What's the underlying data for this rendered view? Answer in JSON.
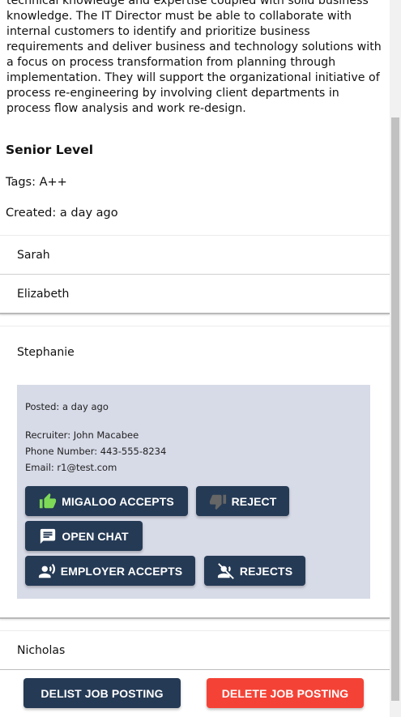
{
  "job": {
    "description": "technical knowledge and expertise coupled with solid business knowledge. The IT Director must be able to collaborate with internal customers to identify and prioritize business requirements and deliver business and technology solutions with a focus on process transformation from planning through implementation. They will support the organizational initiative of process re-engineering by involving client departments in process flow analysis and work re-design.",
    "level": "Senior Level",
    "tags": "Tags: A++",
    "created": "Created: a day ago"
  },
  "candidates": [
    {
      "name": "Sarah"
    },
    {
      "name": "Elizabeth"
    },
    {
      "name": "Stephanie"
    },
    {
      "name": "Nicholas"
    }
  ],
  "details": {
    "posted": "Posted: a day ago",
    "recruiter": "Recruiter: John Macabee",
    "phone": "Phone Number: 443-555-8234",
    "email": "Email: r1@test.com"
  },
  "actions": {
    "migaloo_accepts": "MIGALOO ACCEPTS",
    "reject": "REJECT",
    "open_chat": "OPEN CHAT",
    "employer_accepts": "EMPLOYER ACCEPTS",
    "rejects": "REJECTS"
  },
  "footer": {
    "delist": "DELIST JOB POSTING",
    "delete": "DELETE JOB POSTING"
  },
  "colors": {
    "primary": "#253a55",
    "danger": "#f44336",
    "accept_icon": "#7ed957",
    "reject_icon": "#555555",
    "panel": "#d7dae7"
  }
}
